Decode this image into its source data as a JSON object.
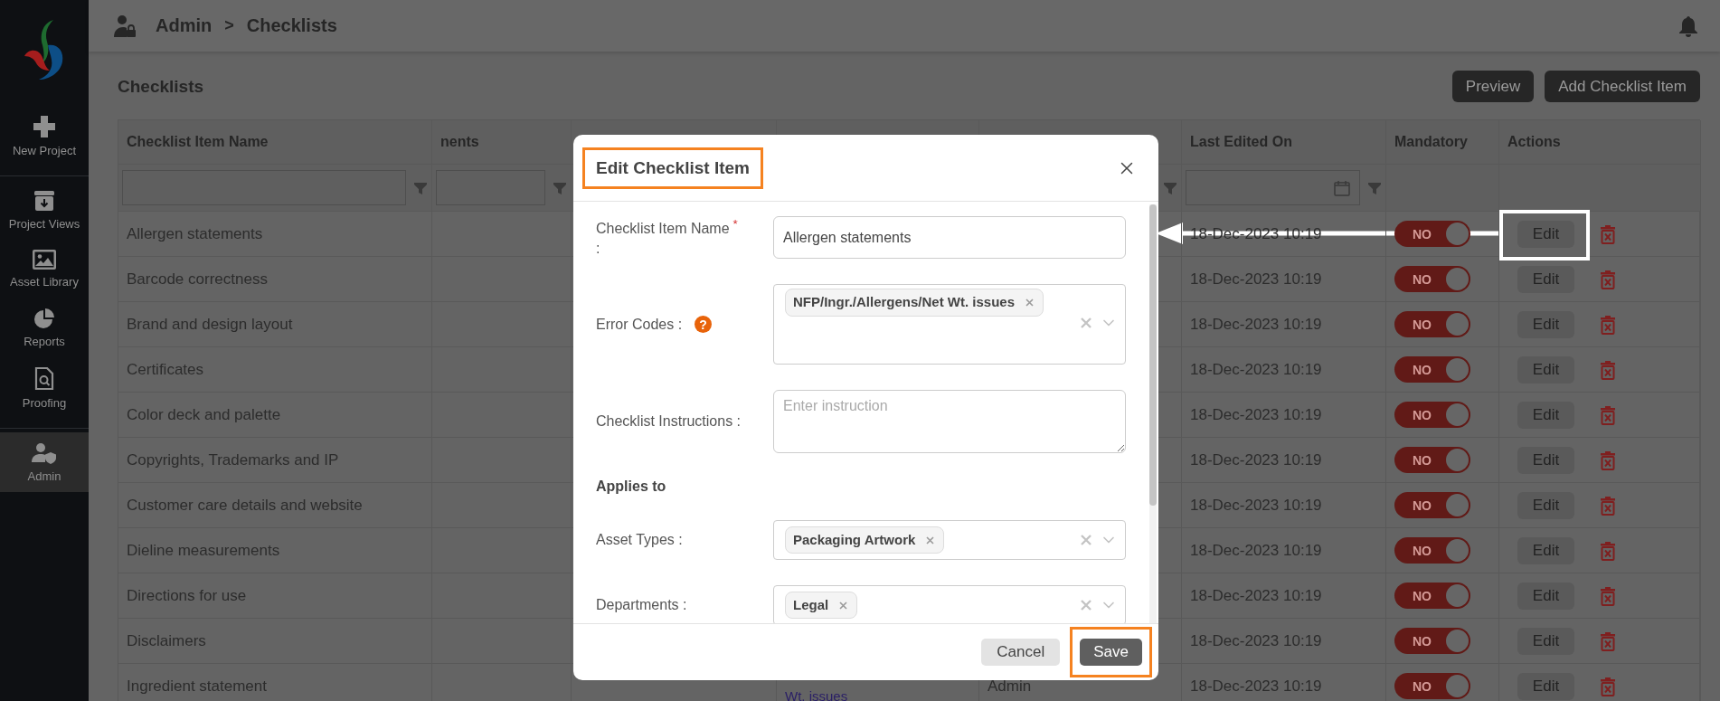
{
  "sidebar": {
    "sections": [
      [
        {
          "label": "New Project",
          "selected": false
        }
      ],
      [
        {
          "label": "Project Views",
          "selected": false
        },
        {
          "label": "Asset Library",
          "selected": false
        },
        {
          "label": "Reports",
          "selected": false
        },
        {
          "label": "Proofing",
          "selected": false
        }
      ],
      [
        {
          "label": "Admin",
          "selected": true
        }
      ]
    ]
  },
  "breadcrumb": {
    "items": [
      "Admin",
      "Checklists"
    ],
    "separator": ">"
  },
  "page_title": "Checklists",
  "toolbar_buttons": [
    "Preview",
    "Add Checklist Item"
  ],
  "table": {
    "columns": [
      {
        "header": "Checklist Item Name",
        "filter": true
      },
      {
        "header": "nents",
        "filter": true
      },
      {},
      {},
      {
        "filter": true
      },
      {
        "header": "Last Edited On",
        "filter": true,
        "calendar": true
      },
      {
        "header": "Mandatory"
      },
      {
        "header": "Actions"
      }
    ],
    "rows": [
      {
        "name": "Allergen statements",
        "last_edited": "18-Dec-2023 10:19",
        "mandatory": {
          "label": "NO",
          "on": false
        },
        "action": "Edit",
        "highlighted": true
      },
      {
        "name": "Barcode correctness",
        "last_edited": "18-Dec-2023 10:19",
        "mandatory": {
          "label": "NO",
          "on": false
        },
        "action": "Edit"
      },
      {
        "name": "Brand and design layout",
        "last_edited": "18-Dec-2023 10:19",
        "mandatory": {
          "label": "NO",
          "on": false
        },
        "action": "Edit"
      },
      {
        "name": "Certificates",
        "last_edited": "18-Dec-2023 10:19",
        "mandatory": {
          "label": "NO",
          "on": false
        },
        "action": "Edit"
      },
      {
        "name": "Color deck and palette",
        "last_edited": "18-Dec-2023 10:19",
        "mandatory": {
          "label": "NO",
          "on": false
        },
        "action": "Edit"
      },
      {
        "name": "Copyrights, Trademarks and IP",
        "last_edited": "18-Dec-2023 10:19",
        "mandatory": {
          "label": "NO",
          "on": false
        },
        "action": "Edit"
      },
      {
        "name": "Customer care details and website",
        "last_edited": "18-Dec-2023 10:19",
        "mandatory": {
          "label": "NO",
          "on": false
        },
        "action": "Edit"
      },
      {
        "name": "Dieline measurements",
        "last_edited": "18-Dec-2023 10:19",
        "mandatory": {
          "label": "NO",
          "on": false
        },
        "action": "Edit"
      },
      {
        "name": "Directions for use",
        "last_edited": "18-Dec-2023 10:19",
        "mandatory": {
          "label": "NO",
          "on": false
        },
        "action": "Edit"
      },
      {
        "name": "Disclaimers",
        "last_edited": "18-Dec-2023 10:19",
        "mandatory": {
          "label": "NO",
          "on": false
        },
        "action": "Edit"
      },
      {
        "name": "Ingredient statement",
        "column_4": "Wt. issues",
        "column_5": "Admin",
        "last_edited": "18-Dec-2023 10:19",
        "mandatory": {
          "label": "NO",
          "on": false
        },
        "action": "Edit"
      }
    ]
  },
  "callout_arrow": true,
  "modal": {
    "title": "Edit Checklist Item",
    "title_highlighted": true,
    "fields": [
      {
        "kind": "text",
        "label": "Checklist Item Name",
        "required_mark": "*",
        "colon": ":",
        "value": "Allergen statements"
      },
      {
        "kind": "multiselect",
        "label": "Error Codes :",
        "help": "?",
        "tags": [
          "NFP/Ingr./Allergens/Net Wt. issues"
        ]
      },
      {
        "kind": "textarea",
        "label": "Checklist Instructions :",
        "placeholder": "Enter instruction"
      },
      {
        "kind": "heading",
        "label": "Applies to"
      },
      {
        "kind": "multiselect",
        "label": "Asset Types :",
        "tags": [
          "Packaging Artwork"
        ]
      },
      {
        "kind": "multiselect",
        "label": "Departments :",
        "tags": [
          "Legal"
        ]
      }
    ],
    "buttons": [
      {
        "label": "Cancel",
        "primary": false,
        "highlighted": false
      },
      {
        "label": "Save",
        "primary": true,
        "highlighted": true
      }
    ]
  }
}
